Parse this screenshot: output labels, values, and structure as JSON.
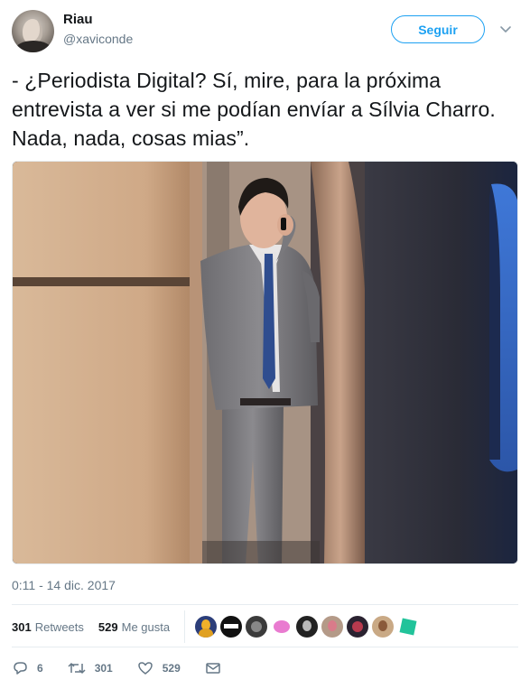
{
  "user": {
    "display_name": "Riau",
    "handle": "@xaviconde"
  },
  "follow_button": {
    "label": "Seguir"
  },
  "tweet": {
    "text": "- ¿Periodista Digital? Sí, mire, para la próxima entrevista a ver si me podían envíar a Sílvia Charro. Nada, nada, cosas mias”.",
    "timestamp": "0:11 - 14 dic. 2017"
  },
  "stats": {
    "retweets_count": "301",
    "retweets_label": "Retweets",
    "likes_count": "529",
    "likes_label": "Me gusta"
  },
  "actions": {
    "replies": "6",
    "retweets": "301",
    "likes": "529"
  },
  "colors": {
    "accent": "#1da1f2",
    "secondary_text": "#657786",
    "divider": "#e6ecf0"
  },
  "icons": [
    "chevron-down-icon",
    "reply-icon",
    "retweet-icon",
    "heart-icon",
    "envelope-icon"
  ]
}
